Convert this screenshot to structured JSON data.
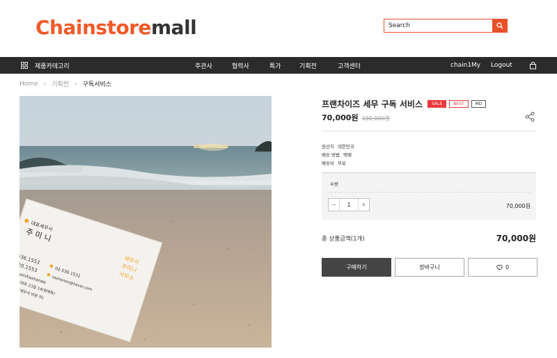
{
  "brand": {
    "logo_part1": "Chainstore",
    "logo_part2": "mall"
  },
  "search": {
    "placeholder": "Search"
  },
  "nav": {
    "category_label": "제품카테고리",
    "menu": [
      "주관사",
      "협력사",
      "특가",
      "기획전",
      "고객센터"
    ],
    "user_name": "chain1",
    "my_label": "My",
    "logout_label": "Logout"
  },
  "breadcrumb": {
    "home": "Home",
    "section": "기획전",
    "current": "구독서비스"
  },
  "product": {
    "title": "프랜차이즈 세무 구독 서비스",
    "badges": {
      "sale": "SALE",
      "best": "BEST",
      "md": "MD"
    },
    "price": "70,000원",
    "original_price": "100,000원",
    "specs": [
      {
        "label": "원산지",
        "value": "대한민국"
      },
      {
        "label": "배송 방법",
        "value": "택배"
      },
      {
        "label": "배송비",
        "value": "무료"
      }
    ],
    "quantity_label": "수량",
    "quantity": "1",
    "line_price": "70,000원",
    "total_label": "총 상품금액(1개)",
    "total_price": "70,000원",
    "buy_label": "구매하기",
    "cart_label": "장바구니",
    "like_count": "0"
  },
  "card": {
    "title": "대표세무사",
    "name": "주 미 니",
    "phone1": "02.536.1553",
    "phone2": "02.536.1531",
    "fax": "0.9420.1553",
    "email": "naver.com/taxhanee",
    "email2": "taxhanee@naver.com",
    "addr1": "서초구 서초대로 23길 14(방배동)",
    "addr2": "401호 (한빛세무서 비원 뒤)",
    "stamp": [
      "세무사",
      "주미니",
      "사무소"
    ]
  },
  "colors": {
    "accent": "#f05a28",
    "nav_bg": "#2b2b2b",
    "sale": "#e8383d",
    "buy_button": "#444444"
  }
}
